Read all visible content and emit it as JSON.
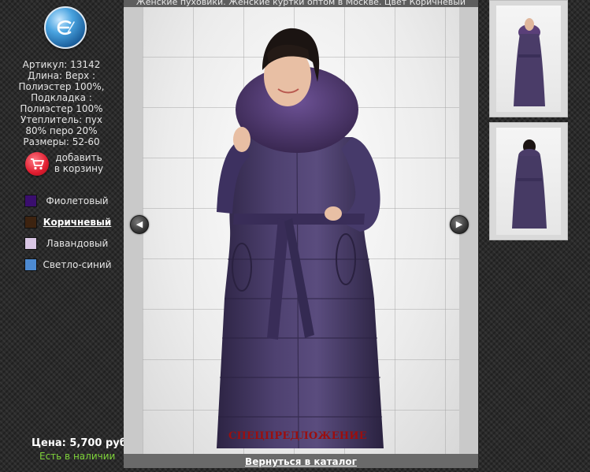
{
  "header": {
    "caption": "Женские пуховики. Женские куртки оптом в Москве. Цвет Коричневый"
  },
  "product": {
    "article": "Артикул: 13142",
    "details": [
      "Длина: Верх :",
      "Полиэстер 100%,",
      "Подкладка :",
      "Полиэстер 100%",
      "Утеплитель: пух",
      "80% перо 20%",
      "Размеры: 52-60"
    ],
    "price": "Цена: 5,700 руб.",
    "stock": "Есть в наличии",
    "special": "СПЕЦПРЕДЛОЖЕНИЕ"
  },
  "cart": {
    "line1": "добавить",
    "line2": "в корзину",
    "icon": "cart-icon"
  },
  "colors": [
    {
      "label": "Фиолетовый",
      "hex": "#3a0e6e",
      "selected": false
    },
    {
      "label": "Коричневый",
      "hex": "#3d2310",
      "selected": true
    },
    {
      "label": "Лавандовый",
      "hex": "#d9c6e4",
      "selected": false
    },
    {
      "label": "Светло-синий",
      "hex": "#4d8ad1",
      "selected": false
    }
  ],
  "gallery": {
    "prev_icon": "chevron-left-icon",
    "next_icon": "chevron-right-icon",
    "back_link": "Вернуться в каталог",
    "coat_color": "#4a3c68",
    "fur_color": "#5a3f79"
  }
}
